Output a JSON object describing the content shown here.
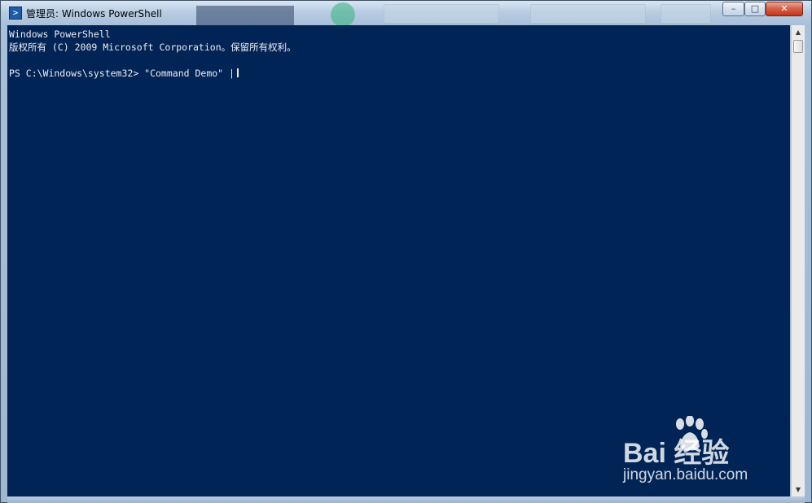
{
  "window": {
    "title": "管理员: Windows PowerShell",
    "controls": {
      "minimize": "–",
      "maximize": "□",
      "close": "✕"
    }
  },
  "console": {
    "lines": [
      "Windows PowerShell",
      "版权所有 (C) 2009 Microsoft Corporation。保留所有权利。",
      "PS C:\\Windows\\system32> \"Command Demo\" |"
    ],
    "background": "#012456",
    "foreground": "#eeedf0"
  },
  "scrollbar": {
    "up_arrow": "▲",
    "down_arrow": "▼"
  },
  "watermark": {
    "brand": "Bai  经验",
    "url": "jingyan.baidu.com"
  },
  "icons": {
    "app": "powershell-icon",
    "watermark": "baidu-paw-icon"
  }
}
